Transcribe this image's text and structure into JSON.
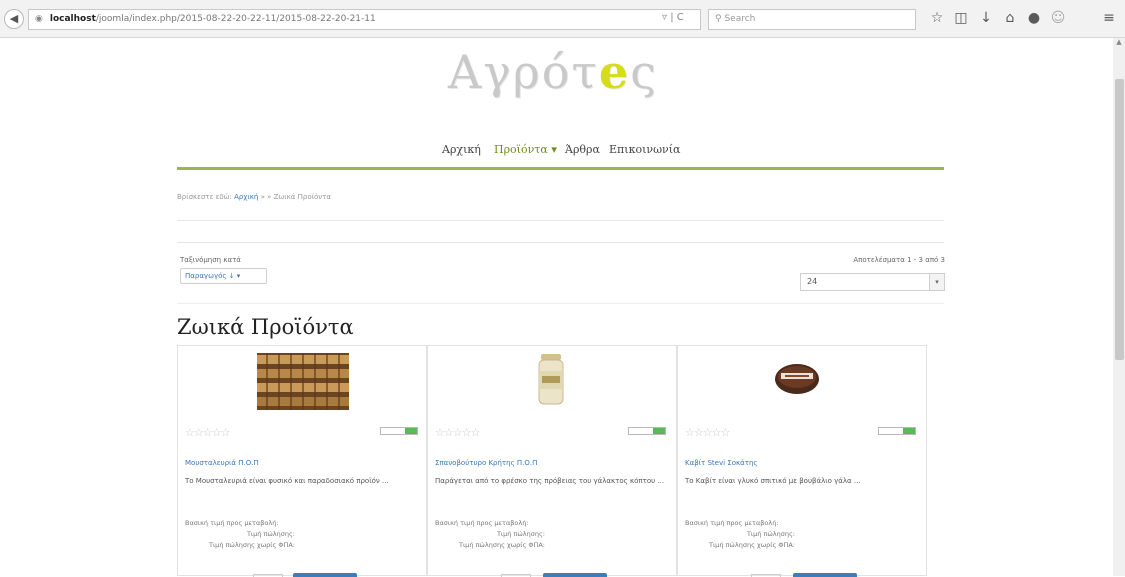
{
  "browser": {
    "url_host": "localhost",
    "url_path": "/joomla/index.php/2015-08-22-20-22-11/2015-08-22-20-21-11",
    "search_placeholder": "Search",
    "url_symbols": "▿  |  C"
  },
  "site": {
    "logo_main": "Αγρότ",
    "logo_accent": "e",
    "logo_end": "ς"
  },
  "nav": {
    "items": [
      {
        "label": "Αρχική"
      },
      {
        "label": "Προϊόντα ▾"
      },
      {
        "label": "Άρθρα"
      },
      {
        "label": "Επικοινωνία"
      }
    ]
  },
  "breadcrumb": {
    "prefix": "Βρίσκεστε εδώ:",
    "home": "Αρχική",
    "separators": "»  »",
    "current": "Ζωικά Προϊόντα"
  },
  "toolbar": {
    "sort_label": "Ταξινόμηση κατά",
    "sort_value": "Παραγωγός ↓ ▾",
    "results_count": "Αποτελέσματα 1 - 3 από 3",
    "limit_value": "24",
    "limit_arrow": "▾"
  },
  "category": {
    "title": "Ζωικά Προϊόντα"
  },
  "products": [
    {
      "name": "Μουσταλευριά Π.Ο.Π",
      "desc": "Το Μουσταλευριά είναι φυσικό και παραδοσιακό προϊόν ...",
      "price_lines": [
        "Βασική τιμή προς μεταβολή:",
        "Τιμή πώλησης:",
        "Τιμή πώλησης χωρίς ΦΠΑ:"
      ]
    },
    {
      "name": "Σπανοβούτυρο Κρήτης Π.Ο.Π",
      "desc": "Παράγεται από το φρέσκο της πρόβειας του γάλακτος κόπτου ...",
      "price_lines": [
        "Βασική τιμή προς μεταβολή:",
        "Τιμή πώλησης:",
        "Τιμή πώλησης χωρίς ΦΠΑ:"
      ]
    },
    {
      "name": "Καβίτ Stevi Σοκάτης",
      "desc": "Το Καβίτ είναι γλυκό σπιτικό με βουβάλιο γάλα ...",
      "price_lines": [
        "Βασική τιμή προς μεταβολή:",
        "Τιμή πώλησης:",
        "Τιμή πώλησης χωρίς ΦΠΑ:"
      ]
    }
  ],
  "icons": {
    "star_row": "☆☆☆☆☆",
    "back": "◀",
    "globe": "◉",
    "search": "⚲",
    "bookmark_star": "☆",
    "clipboard": "◫",
    "download": "↓",
    "home": "⌂",
    "chat": "●",
    "smiley": "☺",
    "menu": "≡",
    "scroll_up": "▲"
  },
  "colors": {
    "accent_green": "#9ab74a",
    "link_blue": "#3b76b8",
    "logo_yellow": "#d5dc18"
  }
}
